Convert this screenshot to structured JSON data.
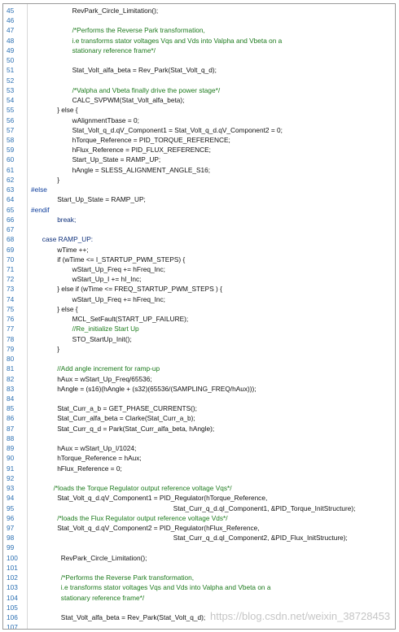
{
  "lines": [
    {
      "n": "45",
      "indent": 11,
      "kind": "code",
      "text": "RevPark_Circle_Limitation();"
    },
    {
      "n": "46",
      "indent": 0,
      "kind": "code",
      "text": ""
    },
    {
      "n": "47",
      "indent": 11,
      "kind": "comment",
      "text": "/*Performs the Reverse Park transformation,"
    },
    {
      "n": "48",
      "indent": 11,
      "kind": "comment",
      "text": "i.e transforms stator voltages Vqs and Vds into Valpha and Vbeta on a"
    },
    {
      "n": "49",
      "indent": 11,
      "kind": "comment",
      "text": "stationary reference frame*/"
    },
    {
      "n": "50",
      "indent": 0,
      "kind": "code",
      "text": ""
    },
    {
      "n": "51",
      "indent": 11,
      "kind": "code",
      "text": "Stat_Volt_alfa_beta = Rev_Park(Stat_Volt_q_d);"
    },
    {
      "n": "52",
      "indent": 0,
      "kind": "code",
      "text": ""
    },
    {
      "n": "53",
      "indent": 11,
      "kind": "comment",
      "text": "/*Valpha and Vbeta finally drive the power stage*/"
    },
    {
      "n": "54",
      "indent": 11,
      "kind": "code",
      "text": "CALC_SVPWM(Stat_Volt_alfa_beta);"
    },
    {
      "n": "55",
      "indent": 7,
      "kind": "code",
      "text": "} else {"
    },
    {
      "n": "56",
      "indent": 11,
      "kind": "code",
      "text": "wAlignmentTbase = 0;"
    },
    {
      "n": "57",
      "indent": 11,
      "kind": "code",
      "text": "Stat_Volt_q_d.qV_Component1 = Stat_Volt_q_d.qV_Component2 = 0;"
    },
    {
      "n": "58",
      "indent": 11,
      "kind": "code",
      "text": "hTorque_Reference = PID_TORQUE_REFERENCE;"
    },
    {
      "n": "59",
      "indent": 11,
      "kind": "code",
      "text": "hFlux_Reference = PID_FLUX_REFERENCE;"
    },
    {
      "n": "60",
      "indent": 11,
      "kind": "code",
      "text": "Start_Up_State = RAMP_UP;"
    },
    {
      "n": "61",
      "indent": 11,
      "kind": "code",
      "text": "hAngle = SLESS_ALIGNMENT_ANGLE_S16;"
    },
    {
      "n": "62",
      "indent": 7,
      "kind": "code",
      "text": "}"
    },
    {
      "n": "63",
      "indent": 0,
      "kind": "directive",
      "text": "#else"
    },
    {
      "n": "64",
      "indent": 7,
      "kind": "code",
      "text": "Start_Up_State = RAMP_UP;"
    },
    {
      "n": "65",
      "indent": 0,
      "kind": "directive",
      "text": "#endif"
    },
    {
      "n": "66",
      "indent": 7,
      "kind": "keyword",
      "text": "break;"
    },
    {
      "n": "67",
      "indent": 0,
      "kind": "code",
      "text": ""
    },
    {
      "n": "68",
      "indent": 3,
      "kind": "keyword",
      "text": "case RAMP_UP:"
    },
    {
      "n": "69",
      "indent": 7,
      "kind": "code",
      "text": "wTime ++;"
    },
    {
      "n": "70",
      "indent": 7,
      "kind": "code",
      "text": "if (wTime <= I_STARTUP_PWM_STEPS) {"
    },
    {
      "n": "71",
      "indent": 11,
      "kind": "code",
      "text": "wStart_Up_Freq += hFreq_Inc;"
    },
    {
      "n": "72",
      "indent": 11,
      "kind": "code",
      "text": "wStart_Up_I += hI_Inc;"
    },
    {
      "n": "73",
      "indent": 7,
      "kind": "code",
      "text": "} else if (wTime <= FREQ_STARTUP_PWM_STEPS ) {"
    },
    {
      "n": "74",
      "indent": 11,
      "kind": "code",
      "text": "wStart_Up_Freq += hFreq_Inc;"
    },
    {
      "n": "75",
      "indent": 7,
      "kind": "code",
      "text": "} else {"
    },
    {
      "n": "76",
      "indent": 11,
      "kind": "code",
      "text": "MCL_SetFault(START_UP_FAILURE);"
    },
    {
      "n": "77",
      "indent": 11,
      "kind": "comment",
      "text": "//Re_initialize Start Up"
    },
    {
      "n": "78",
      "indent": 11,
      "kind": "code",
      "text": "STO_StartUp_Init();"
    },
    {
      "n": "79",
      "indent": 7,
      "kind": "code",
      "text": "}"
    },
    {
      "n": "80",
      "indent": 0,
      "kind": "code",
      "text": ""
    },
    {
      "n": "81",
      "indent": 7,
      "kind": "comment",
      "text": "//Add angle increment for ramp-up"
    },
    {
      "n": "82",
      "indent": 7,
      "kind": "code",
      "text": "hAux = wStart_Up_Freq/65536;"
    },
    {
      "n": "83",
      "indent": 7,
      "kind": "code",
      "text": "hAngle = (s16)(hAngle + (s32)(65536/(SAMPLING_FREQ/hAux)));"
    },
    {
      "n": "84",
      "indent": 0,
      "kind": "code",
      "text": ""
    },
    {
      "n": "85",
      "indent": 7,
      "kind": "code",
      "text": "Stat_Curr_a_b = GET_PHASE_CURRENTS();"
    },
    {
      "n": "86",
      "indent": 7,
      "kind": "code",
      "text": "Stat_Curr_alfa_beta = Clarke(Stat_Curr_a_b);"
    },
    {
      "n": "87",
      "indent": 7,
      "kind": "code",
      "text": "Stat_Curr_q_d = Park(Stat_Curr_alfa_beta, hAngle);"
    },
    {
      "n": "88",
      "indent": 0,
      "kind": "code",
      "text": ""
    },
    {
      "n": "89",
      "indent": 7,
      "kind": "code",
      "text": "hAux = wStart_Up_I/1024;"
    },
    {
      "n": "90",
      "indent": 7,
      "kind": "code",
      "text": "hTorque_Reference = hAux;"
    },
    {
      "n": "91",
      "indent": 7,
      "kind": "code",
      "text": "hFlux_Reference = 0;"
    },
    {
      "n": "92",
      "indent": 0,
      "kind": "code",
      "text": ""
    },
    {
      "n": "93",
      "indent": 6,
      "kind": "comment",
      "text": "/*loads the Torque Regulator output reference voltage Vqs*/"
    },
    {
      "n": "94",
      "indent": 7,
      "kind": "code",
      "text": "Stat_Volt_q_d.qV_Component1 = PID_Regulator(hTorque_Reference,"
    },
    {
      "n": "95",
      "indent": 38,
      "kind": "code",
      "text": "Stat_Curr_q_d.qI_Component1, &PID_Torque_InitStructure);"
    },
    {
      "n": "96",
      "indent": 7,
      "kind": "comment",
      "text": "/*loads the Flux Regulator output reference voltage Vds*/"
    },
    {
      "n": "97",
      "indent": 7,
      "kind": "code",
      "text": "Stat_Volt_q_d.qV_Component2 = PID_Regulator(hFlux_Reference,"
    },
    {
      "n": "98",
      "indent": 38,
      "kind": "code",
      "text": "Stat_Curr_q_d.qI_Component2, &PID_Flux_InitStructure);"
    },
    {
      "n": "99",
      "indent": 0,
      "kind": "code",
      "text": ""
    },
    {
      "n": "100",
      "indent": 8,
      "kind": "code",
      "text": "RevPark_Circle_Limitation();"
    },
    {
      "n": "101",
      "indent": 0,
      "kind": "code",
      "text": ""
    },
    {
      "n": "102",
      "indent": 8,
      "kind": "comment",
      "text": "/*Performs the Reverse Park transformation,"
    },
    {
      "n": "103",
      "indent": 8,
      "kind": "comment",
      "text": "i.e transforms stator voltages Vqs and Vds into Valpha and Vbeta on a"
    },
    {
      "n": "104",
      "indent": 8,
      "kind": "comment",
      "text": "stationary reference frame*/"
    },
    {
      "n": "105",
      "indent": 0,
      "kind": "code",
      "text": ""
    },
    {
      "n": "106",
      "indent": 8,
      "kind": "code",
      "text": "Stat_Volt_alfa_beta = Rev_Park(Stat_Volt_q_d);"
    },
    {
      "n": "107",
      "indent": 0,
      "kind": "code",
      "text": ""
    }
  ],
  "watermark": "https://blog.csdn.net/weixin_38728453"
}
